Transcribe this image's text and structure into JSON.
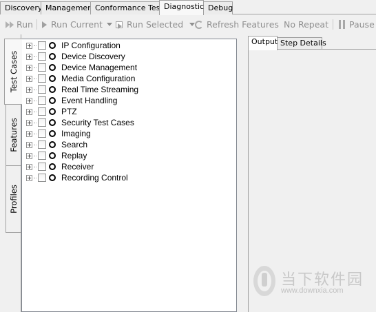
{
  "top_tabs": [
    {
      "label": "Discovery"
    },
    {
      "label": "Management"
    },
    {
      "label": "Conformance Test"
    },
    {
      "label": "Diagnostic",
      "active": true
    },
    {
      "label": "Debug"
    }
  ],
  "toolbar": {
    "run": "Run",
    "run_current": "Run Current",
    "run_selected": "Run Selected",
    "refresh_features": "Refresh Features",
    "no_repeat": "No Repeat",
    "pause": "Pause"
  },
  "side_tabs": [
    {
      "label": "Test Cases",
      "active": true
    },
    {
      "label": "Features"
    },
    {
      "label": "Profiles"
    }
  ],
  "tree": {
    "items": [
      {
        "label": "IP Configuration"
      },
      {
        "label": "Device Discovery"
      },
      {
        "label": "Device Management"
      },
      {
        "label": "Media Configuration"
      },
      {
        "label": "Real Time Streaming"
      },
      {
        "label": "Event Handling"
      },
      {
        "label": "PTZ"
      },
      {
        "label": "Security Test Cases"
      },
      {
        "label": "Imaging"
      },
      {
        "label": "Search"
      },
      {
        "label": "Replay"
      },
      {
        "label": "Receiver"
      },
      {
        "label": "Recording Control"
      }
    ]
  },
  "output_tabs": [
    {
      "label": "Output",
      "active": true
    },
    {
      "label": "Step Details"
    }
  ],
  "watermark": {
    "text": "当下软件园",
    "url": "www.downxia.com"
  }
}
